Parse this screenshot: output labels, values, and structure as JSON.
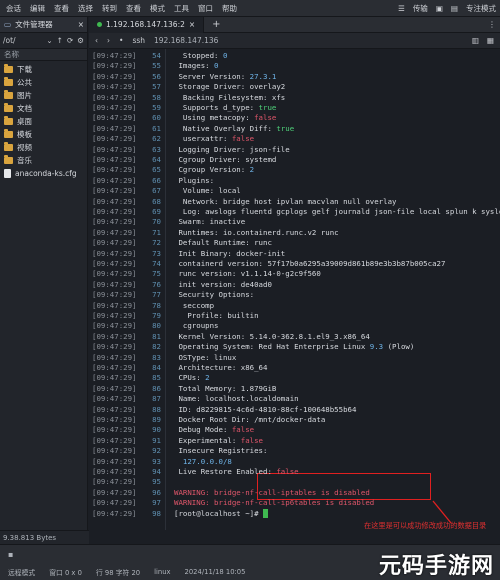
{
  "menubar": {
    "items": [
      "会话",
      "编辑",
      "查看",
      "选择",
      "转到",
      "查看",
      "模式",
      "工具",
      "窗口",
      "帮助"
    ],
    "right_items": [
      "☰",
      "传输",
      "▣",
      "▤",
      "专注模式"
    ]
  },
  "left_panel": {
    "title": "文件管理器",
    "path": "/ot/",
    "column_header": "名称",
    "files": [
      {
        "name": "下载",
        "type": "folder"
      },
      {
        "name": "公共",
        "type": "folder"
      },
      {
        "name": "图片",
        "type": "folder"
      },
      {
        "name": "文档",
        "type": "folder"
      },
      {
        "name": "桌面",
        "type": "folder"
      },
      {
        "name": "模板",
        "type": "folder"
      },
      {
        "name": "视频",
        "type": "folder"
      },
      {
        "name": "音乐",
        "type": "folder"
      },
      {
        "name": "anaconda-ks.cfg",
        "type": "file"
      }
    ],
    "footer": "9.38.813 Bytes"
  },
  "tabs": [
    {
      "label": "1.192.168.147.136:2"
    }
  ],
  "ssh_bar": {
    "prefix": "ssh",
    "address": "192.168.147.136"
  },
  "terminal": {
    "timestamp": "[09:47:29]",
    "lines": [
      {
        "n": "54",
        "segs": [
          [
            "  Stopped: ",
            ""
          ],
          [
            "0",
            "num"
          ]
        ]
      },
      {
        "n": "55",
        "segs": [
          [
            " Images: ",
            ""
          ],
          [
            "0",
            "num"
          ]
        ]
      },
      {
        "n": "56",
        "segs": [
          [
            " Server Version: ",
            ""
          ],
          [
            "27.3.1",
            "num"
          ]
        ]
      },
      {
        "n": "57",
        "segs": [
          [
            " Storage Driver: overlay2",
            ""
          ]
        ]
      },
      {
        "n": "58",
        "segs": [
          [
            "  Backing Filesystem: xfs",
            ""
          ]
        ]
      },
      {
        "n": "59",
        "segs": [
          [
            "  Supports d_type: ",
            ""
          ],
          [
            "true",
            "true"
          ]
        ]
      },
      {
        "n": "60",
        "segs": [
          [
            "  Using metacopy: ",
            ""
          ],
          [
            "false",
            "false"
          ]
        ]
      },
      {
        "n": "61",
        "segs": [
          [
            "  Native Overlay Diff: ",
            ""
          ],
          [
            "true",
            "true"
          ]
        ]
      },
      {
        "n": "62",
        "segs": [
          [
            "  userxattr: ",
            ""
          ],
          [
            "false",
            "false"
          ]
        ]
      },
      {
        "n": "63",
        "segs": [
          [
            " Logging Driver: json-file",
            ""
          ]
        ]
      },
      {
        "n": "64",
        "segs": [
          [
            " Cgroup Driver: systemd",
            ""
          ]
        ]
      },
      {
        "n": "65",
        "segs": [
          [
            " Cgroup Version: ",
            ""
          ],
          [
            "2",
            "num"
          ]
        ]
      },
      {
        "n": "66",
        "segs": [
          [
            " Plugins:",
            ""
          ]
        ]
      },
      {
        "n": "67",
        "segs": [
          [
            "  Volume: local",
            ""
          ]
        ]
      },
      {
        "n": "68",
        "segs": [
          [
            "  Network: bridge host ipvlan macvlan null overlay",
            ""
          ]
        ]
      },
      {
        "n": "69",
        "segs": [
          [
            "  Log: awslogs fluentd gcplogs gelf journald json-file local splun ",
            ""
          ],
          [
            "k syslog",
            ""
          ]
        ]
      },
      {
        "n": "70",
        "segs": [
          [
            " Swarm: inactive",
            ""
          ]
        ]
      },
      {
        "n": "71",
        "segs": [
          [
            " Runtimes: io.containerd.runc.v2 runc",
            ""
          ]
        ]
      },
      {
        "n": "72",
        "segs": [
          [
            " Default Runtime: runc",
            ""
          ]
        ]
      },
      {
        "n": "73",
        "segs": [
          [
            " Init Binary: docker-init",
            ""
          ]
        ]
      },
      {
        "n": "74",
        "segs": [
          [
            " containerd version: 57f17b0a6295a39009d861b89e3b3b87b005ca27",
            ""
          ]
        ]
      },
      {
        "n": "75",
        "segs": [
          [
            " runc version: v1.1.14-0-g2c9f560",
            ""
          ]
        ]
      },
      {
        "n": "76",
        "segs": [
          [
            " init version: de40ad0",
            ""
          ]
        ]
      },
      {
        "n": "77",
        "segs": [
          [
            " Security Options:",
            ""
          ]
        ]
      },
      {
        "n": "78",
        "segs": [
          [
            "  seccomp",
            ""
          ]
        ]
      },
      {
        "n": "79",
        "segs": [
          [
            "   Profile: builtin",
            ""
          ]
        ]
      },
      {
        "n": "80",
        "segs": [
          [
            "  cgroupns",
            ""
          ]
        ]
      },
      {
        "n": "81",
        "segs": [
          [
            " Kernel Version: 5.14.0-362.8.1.el9_3.x86_64",
            ""
          ]
        ]
      },
      {
        "n": "82",
        "segs": [
          [
            " Operating System: Red Hat Enterprise Linux ",
            ""
          ],
          [
            "9.3",
            "num"
          ],
          [
            " (Plow)",
            ""
          ]
        ]
      },
      {
        "n": "83",
        "segs": [
          [
            " OSType: linux",
            ""
          ]
        ]
      },
      {
        "n": "84",
        "segs": [
          [
            " Architecture: x86_64",
            ""
          ]
        ]
      },
      {
        "n": "85",
        "segs": [
          [
            " CPUs: ",
            ""
          ],
          [
            "2",
            "num"
          ]
        ]
      },
      {
        "n": "86",
        "segs": [
          [
            " Total Memory: 1.879GiB",
            ""
          ]
        ]
      },
      {
        "n": "87",
        "segs": [
          [
            " Name: localhost.localdomain",
            ""
          ]
        ]
      },
      {
        "n": "88",
        "segs": [
          [
            " ID: d8229815-4c6d-4810-88cf-100648b55b64",
            ""
          ]
        ]
      },
      {
        "n": "89",
        "segs": [
          [
            " Docker Root Dir: /mnt/docker-data",
            ""
          ]
        ]
      },
      {
        "n": "90",
        "segs": [
          [
            " Debug Mode: ",
            ""
          ],
          [
            "false",
            "false"
          ]
        ]
      },
      {
        "n": "91",
        "segs": [
          [
            " Experimental: ",
            ""
          ],
          [
            "false",
            "false"
          ]
        ]
      },
      {
        "n": "92",
        "segs": [
          [
            " Insecure Registries:",
            ""
          ]
        ]
      },
      {
        "n": "93",
        "segs": [
          [
            "  127.0.0.0/8",
            "num"
          ]
        ]
      },
      {
        "n": "94",
        "segs": [
          [
            " Live Restore Enabled: ",
            ""
          ],
          [
            "false",
            "false"
          ]
        ]
      },
      {
        "n": "95",
        "segs": [
          [
            "",
            ""
          ]
        ]
      },
      {
        "n": "96",
        "segs": [
          [
            "WARNING: bridge-nf-call-iptables is disabled",
            "warn"
          ]
        ]
      },
      {
        "n": "97",
        "segs": [
          [
            "WARNING: bridge-nf-call-ip6tables is disabled",
            "warn"
          ]
        ]
      },
      {
        "n": "98",
        "segs": [
          [
            "[root@localhost ~]# ",
            ""
          ]
        ]
      }
    ],
    "annotation": "在这里是可以成功修改成功的数据目录"
  },
  "status": {
    "items": [
      "远程模式",
      "窗口 0 x 0",
      "行 98 字符 20",
      "linux",
      "2024/11/18 10:05"
    ],
    "watermark": "元码手游网"
  }
}
